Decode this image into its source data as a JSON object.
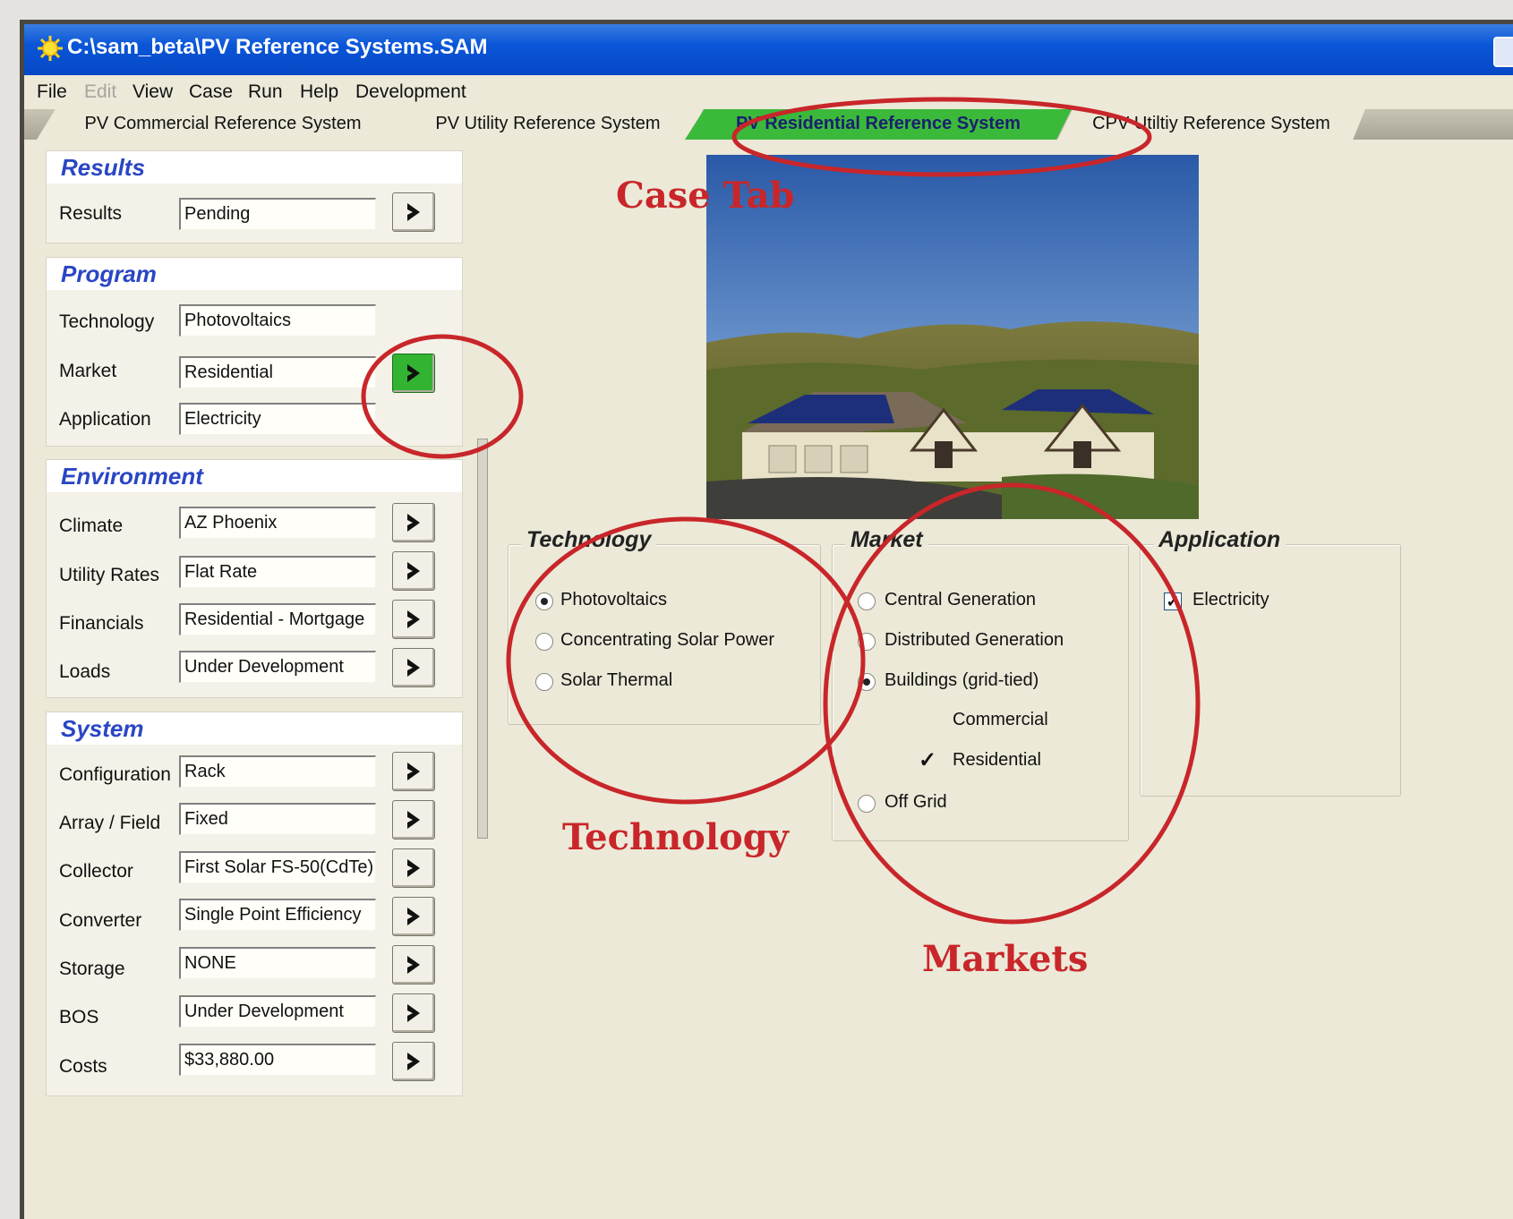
{
  "window": {
    "title": "C:\\sam_beta\\PV Reference Systems.SAM"
  },
  "menu": [
    "File",
    "Edit",
    "View",
    "Case",
    "Run",
    "Help",
    "Development"
  ],
  "tabs": [
    {
      "label": "PV Commercial Reference System",
      "active": false
    },
    {
      "label": "PV Utility Reference System",
      "active": false
    },
    {
      "label": "PV Residential Reference System",
      "active": true
    },
    {
      "label": "CPV Utiltiy Reference System",
      "active": false
    }
  ],
  "sections": {
    "results": {
      "title": "Results",
      "rows": [
        {
          "label": "Results",
          "value": "Pending"
        }
      ]
    },
    "program": {
      "title": "Program",
      "rows": [
        {
          "label": "Technology",
          "value": "Photovoltaics"
        },
        {
          "label": "Market",
          "value": "Residential"
        },
        {
          "label": "Application",
          "value": "Electricity"
        }
      ]
    },
    "environment": {
      "title": "Environment",
      "rows": [
        {
          "label": "Climate",
          "value": "AZ Phoenix"
        },
        {
          "label": "Utility Rates",
          "value": "Flat Rate"
        },
        {
          "label": "Financials",
          "value": "Residential - Mortgage"
        },
        {
          "label": "Loads",
          "value": "Under Development"
        }
      ]
    },
    "system": {
      "title": "System",
      "rows": [
        {
          "label": "Configuration",
          "value": "Rack"
        },
        {
          "label": "Array / Field",
          "value": "Fixed"
        },
        {
          "label": "Collector",
          "value": "First Solar FS-50(CdTe)"
        },
        {
          "label": "Converter",
          "value": "Single Point Efficiency"
        },
        {
          "label": "Storage",
          "value": "NONE"
        },
        {
          "label": "BOS",
          "value": "Under Development"
        },
        {
          "label": "Costs",
          "value": "$33,880.00"
        }
      ]
    }
  },
  "technology": {
    "title": "Technology",
    "options": [
      {
        "label": "Photovoltaics",
        "selected": true
      },
      {
        "label": "Concentrating Solar Power",
        "selected": false
      },
      {
        "label": "Solar Thermal",
        "selected": false
      }
    ]
  },
  "market": {
    "title": "Market",
    "options": [
      {
        "label": "Central Generation",
        "selected": false
      },
      {
        "label": "Distributed Generation",
        "selected": false
      },
      {
        "label": "Buildings (grid-tied)",
        "selected": true
      },
      {
        "label": "Off Grid",
        "selected": false
      }
    ],
    "sub_options": [
      {
        "label": "Commercial",
        "checked": false
      },
      {
        "label": "Residential",
        "checked": true
      }
    ]
  },
  "application": {
    "title": "Application",
    "options": [
      {
        "label": "Electricity",
        "checked": true
      }
    ]
  },
  "annotations": {
    "case_tab": "Case Tab",
    "technology": "Technology",
    "markets": "Markets"
  },
  "colors": {
    "annotation": "#c8262a",
    "titlebar": "#0a56d8",
    "active_tab": "#3bb93b",
    "section_title": "#2a46c4"
  }
}
